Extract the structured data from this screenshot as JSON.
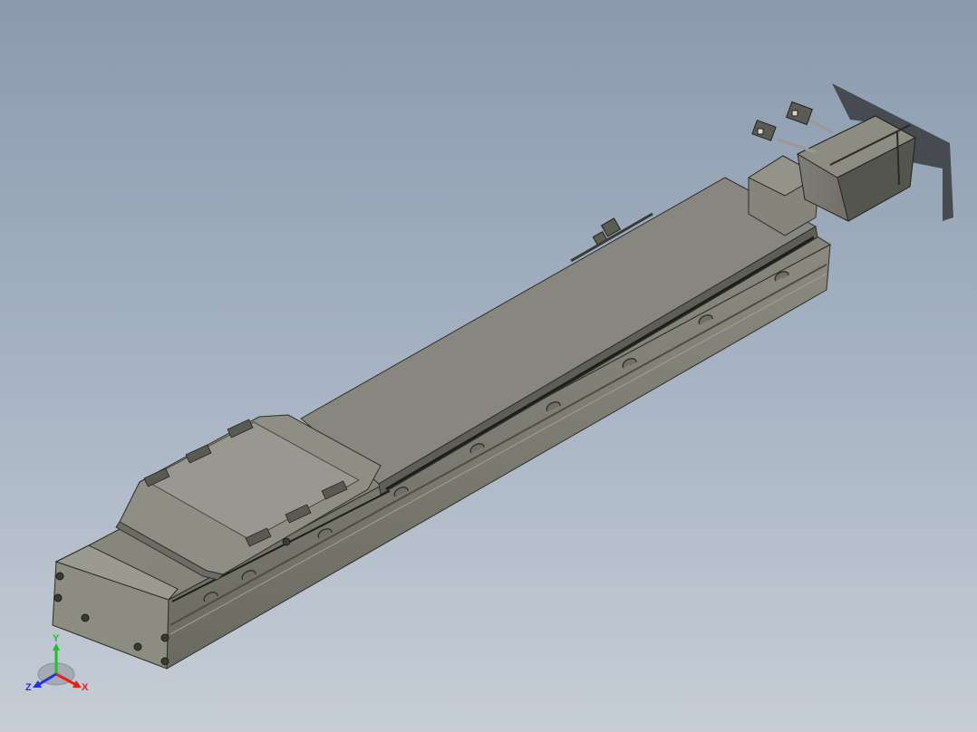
{
  "view": {
    "background_top": "#8b9aae",
    "background_bottom": "#c6cdd6",
    "model_color": "#858578"
  },
  "triad": {
    "x_label": "X",
    "y_label": "Y",
    "z_label": "Z",
    "x_color": "#e8201c",
    "y_color": "#1fbf2a",
    "z_color": "#2433e0"
  }
}
